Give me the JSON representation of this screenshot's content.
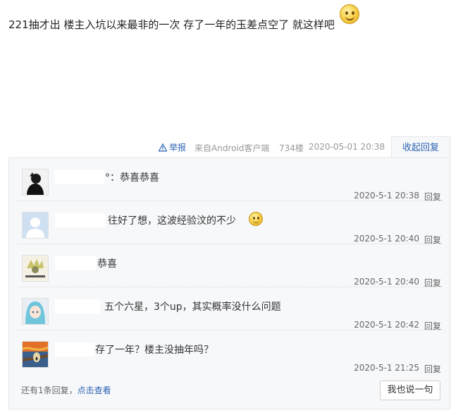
{
  "post": {
    "text": "221抽才出 楼主入坑以来最非的一次 存了一年的玉差点空了 就这样吧"
  },
  "meta": {
    "report_label": "举报",
    "client": "来自Android客户端",
    "floor": "734楼",
    "time": "2020-05-01 20:38",
    "collapse_label": "收起回复"
  },
  "replies": [
    {
      "text": "°：恭喜恭喜",
      "time": "2020-5-1 20:38",
      "reply_label": "回复",
      "avatar": "dark-silhouette"
    },
    {
      "text": "往好了想，这波经验汶的不少",
      "time": "2020-5-1 20:40",
      "reply_label": "回复",
      "avatar": "default-user"
    },
    {
      "text": "恭喜",
      "time": "2020-5-1 20:40",
      "reply_label": "回复",
      "avatar": "meme-image"
    },
    {
      "text": "五个六星，3个up，其实概率没什么问题",
      "time": "2020-5-1 20:42",
      "reply_label": "回复",
      "avatar": "blue-hair-character"
    },
    {
      "text": "存了一年？楼主没抽年吗？",
      "time": "2020-5-1 21:25",
      "reply_label": "回复",
      "avatar": "scream-painting"
    }
  ],
  "footer": {
    "more_prefix": "还有1条回复，",
    "more_link": "点击查看",
    "say_button": "我也说一句"
  },
  "colors": {
    "link": "#2d64b3",
    "reply_bg": "#f7f8fa",
    "border": "#e6e6e6"
  }
}
